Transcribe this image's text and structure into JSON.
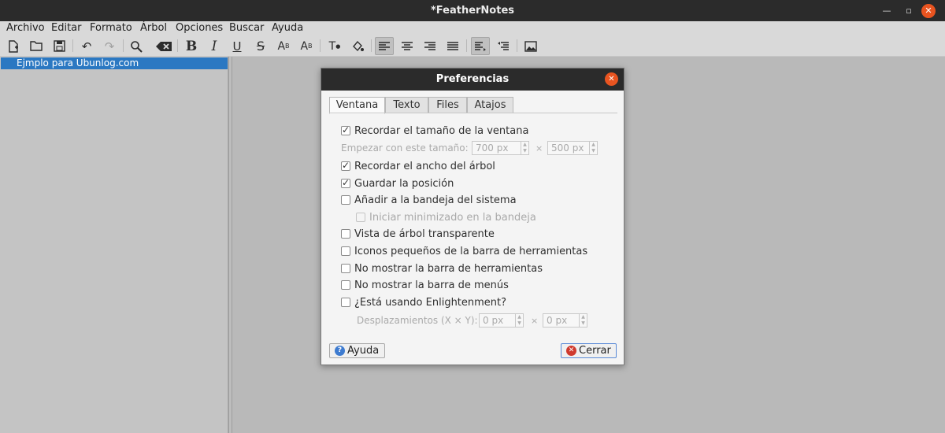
{
  "window": {
    "title": "*FeatherNotes"
  },
  "menu": [
    "Archivo",
    "Editar",
    "Formato",
    "Árbol",
    "Opciones",
    "Buscar",
    "Ayuda"
  ],
  "tree": {
    "items": [
      "Ejmplo para Ubunlog.com"
    ]
  },
  "dialog": {
    "title": "Preferencias",
    "tabs": [
      "Ventana",
      "Texto",
      "Files",
      "Atajos"
    ],
    "options": {
      "remember_size": "Recordar el tamaño de la ventana",
      "start_size_label": "Empezar con este tamaño:",
      "start_width": "700 px",
      "start_height": "500 px",
      "times": "×",
      "remember_tree_width": "Recordar el ancho del árbol",
      "save_position": "Guardar la posición",
      "add_to_tray": "Añadir a la bandeja del sistema",
      "start_minimized": "Iniciar minimizado en la bandeja",
      "transparent_tree": "Vista de árbol transparente",
      "small_icons": "Iconos pequeños de la barra de herramientas",
      "hide_toolbar": "No mostrar la barra de herramientas",
      "hide_menubar": "No mostrar la barra de menús",
      "enlightenment": "¿Está usando Enlightenment?",
      "offsets_label": "Desplazamientos (X × Y):",
      "offset_x": "0 px",
      "offset_y": "0 px"
    },
    "buttons": {
      "help": "Ayuda",
      "close": "Cerrar"
    }
  },
  "colors": {
    "accent": "#e95420",
    "selection": "#2b78c2"
  }
}
